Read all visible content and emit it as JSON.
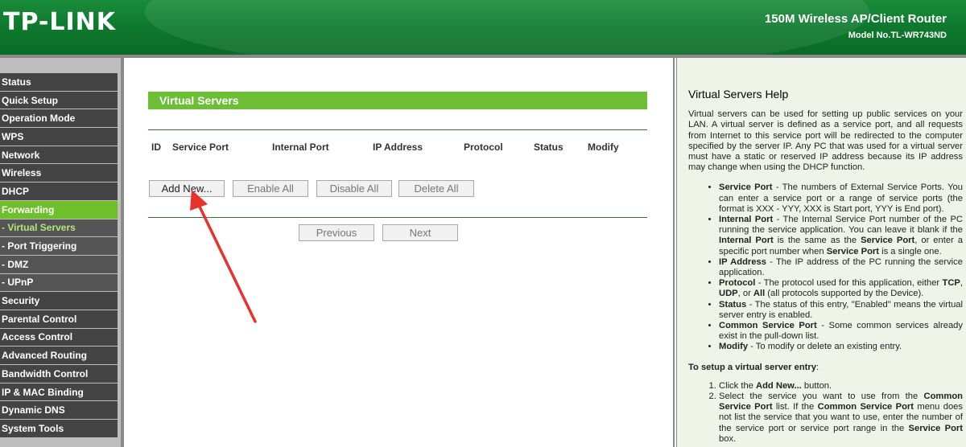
{
  "header": {
    "logo": "TP-LINK",
    "product": "150M Wireless AP/Client Router",
    "model": "Model No.TL-WR743ND"
  },
  "sidebar": {
    "items": [
      {
        "label": "Status",
        "type": "main"
      },
      {
        "label": "Quick Setup",
        "type": "main"
      },
      {
        "label": "Operation Mode",
        "type": "main"
      },
      {
        "label": "WPS",
        "type": "main"
      },
      {
        "label": "Network",
        "type": "main"
      },
      {
        "label": "Wireless",
        "type": "main"
      },
      {
        "label": "DHCP",
        "type": "main"
      },
      {
        "label": "Forwarding",
        "type": "active"
      },
      {
        "label": "- Virtual Servers",
        "type": "sub-selected"
      },
      {
        "label": "- Port Triggering",
        "type": "sub"
      },
      {
        "label": "- DMZ",
        "type": "sub"
      },
      {
        "label": "- UPnP",
        "type": "sub"
      },
      {
        "label": "Security",
        "type": "main"
      },
      {
        "label": "Parental Control",
        "type": "main"
      },
      {
        "label": "Access Control",
        "type": "main"
      },
      {
        "label": "Advanced Routing",
        "type": "main"
      },
      {
        "label": "Bandwidth Control",
        "type": "main"
      },
      {
        "label": "IP & MAC Binding",
        "type": "main"
      },
      {
        "label": "Dynamic DNS",
        "type": "main"
      },
      {
        "label": "System Tools",
        "type": "main"
      }
    ]
  },
  "main": {
    "title": "Virtual Servers",
    "columns": [
      "ID",
      "Service Port",
      "Internal Port",
      "IP Address",
      "Protocol",
      "Status",
      "Modify"
    ],
    "buttons": {
      "add_new": "Add New...",
      "enable_all": "Enable All",
      "disable_all": "Disable All",
      "delete_all": "Delete All",
      "previous": "Previous",
      "next": "Next"
    }
  },
  "help": {
    "title": "Virtual Servers Help",
    "intro": "Virtual servers can be used for setting up public services on your LAN. A virtual server is defined as a service port, and all requests from Internet to this service port will be redirected to the computer specified by the server IP. Any PC that was used for a virtual server must have a static or reserved IP address because its IP address may change when using the DHCP function.",
    "items": [
      {
        "term": "Service Port",
        "text": " - The numbers of External Service Ports. You can enter a service port or a range of service ports (the format is XXX - YYY, XXX is Start port, YYY is End port)."
      },
      {
        "term": "Internal Port",
        "text": " - The Internal Service Port number of the PC running the service application. You can leave it blank if the ",
        "term2": "Internal Port",
        "text2": " is the same as the ",
        "term3": "Service Port",
        "text3": ", or enter a specific port number when ",
        "term4": "Service Port",
        "text4": " is a single one."
      },
      {
        "term": "IP Address",
        "text": " - The IP address of the PC running the service application."
      },
      {
        "term": "Protocol",
        "text": " - The protocol used for this application, either ",
        "term2": "TCP",
        "text2": ", ",
        "term3": "UDP",
        "text3": ", or ",
        "term4": "All",
        "text4": " (all protocols supported by the Device)."
      },
      {
        "term": "Status",
        "text": " - The status of this entry, \"Enabled\" means the virtual server entry is enabled."
      },
      {
        "term": "Common Service Port",
        "text": " - Some common services already exist in the pull-down list."
      },
      {
        "term": "Modify",
        "text": " - To modify or delete an existing entry."
      }
    ],
    "setup_title": "To setup a virtual server entry",
    "setup_colon": ":",
    "steps": [
      {
        "pre": "Click the ",
        "term": "Add New...",
        "post": " button."
      },
      {
        "pre": "Select the service you want to use from the ",
        "term": "Common Service Port",
        "mid": " list. If the ",
        "term2": "Common Service Port",
        "mid2": " menu does not list the service that you want to use, enter the number of the service port or service port range in the ",
        "term3": "Service Port",
        "post": " box."
      }
    ]
  },
  "colors": {
    "brand_green": "#0f7a2f",
    "accent_green": "#6cbf34",
    "menu_dark": "#444444",
    "annotation_arrow": "#e8322b"
  }
}
